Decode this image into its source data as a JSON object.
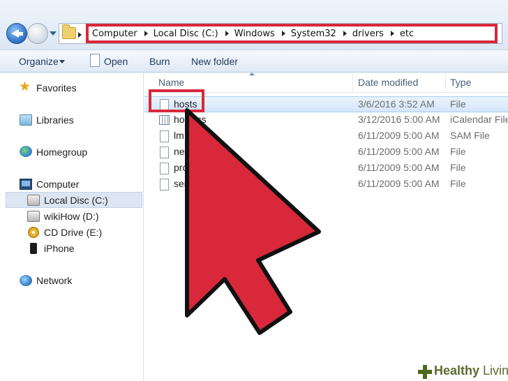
{
  "address_bar": {
    "crumbs": [
      "Computer",
      "Local Disc (C:)",
      "Windows",
      "System32",
      "drivers",
      "etc"
    ]
  },
  "toolbar": {
    "organize_label": "Organize",
    "open_label": "Open",
    "burn_label": "Burn",
    "new_folder_label": "New folder"
  },
  "nav": {
    "favorites": "Favorites",
    "libraries": "Libraries",
    "homegroup": "Homegroup",
    "computer": "Computer",
    "local_disc": "Local Disc (C:)",
    "wikihow": "wikiHow (D:)",
    "cd_drive": "CD Drive (E:)",
    "iphone": "iPhone",
    "network": "Network"
  },
  "columns": {
    "name": "Name",
    "date": "Date modified",
    "type": "Type"
  },
  "files": [
    {
      "name": "hosts",
      "date": "3/6/2016 3:52 AM",
      "type": "File"
    },
    {
      "name": "hosts.ics",
      "name_visible": "ho…ics",
      "date": "3/12/2016 5:00 AM",
      "type": "iCalendar File"
    },
    {
      "name": "lmhosts.sam",
      "name_visible": "lm…m",
      "date": "6/11/2009 5:00 AM",
      "type": "SAM File"
    },
    {
      "name": "networks",
      "name_visible": "net",
      "date": "6/11/2009 5:00 AM",
      "type": "File"
    },
    {
      "name": "protocol",
      "name_visible": "pro",
      "date": "6/11/2009 5:00 AM",
      "type": "File"
    },
    {
      "name": "services",
      "name_visible": "ser",
      "date": "6/11/2009 5:00 AM",
      "type": "File"
    }
  ],
  "watermark": {
    "word1": "Healthy",
    "word2": "Living"
  },
  "colors": {
    "highlight_red": "#d8283a",
    "selection_blue": "#d4e6fa"
  }
}
